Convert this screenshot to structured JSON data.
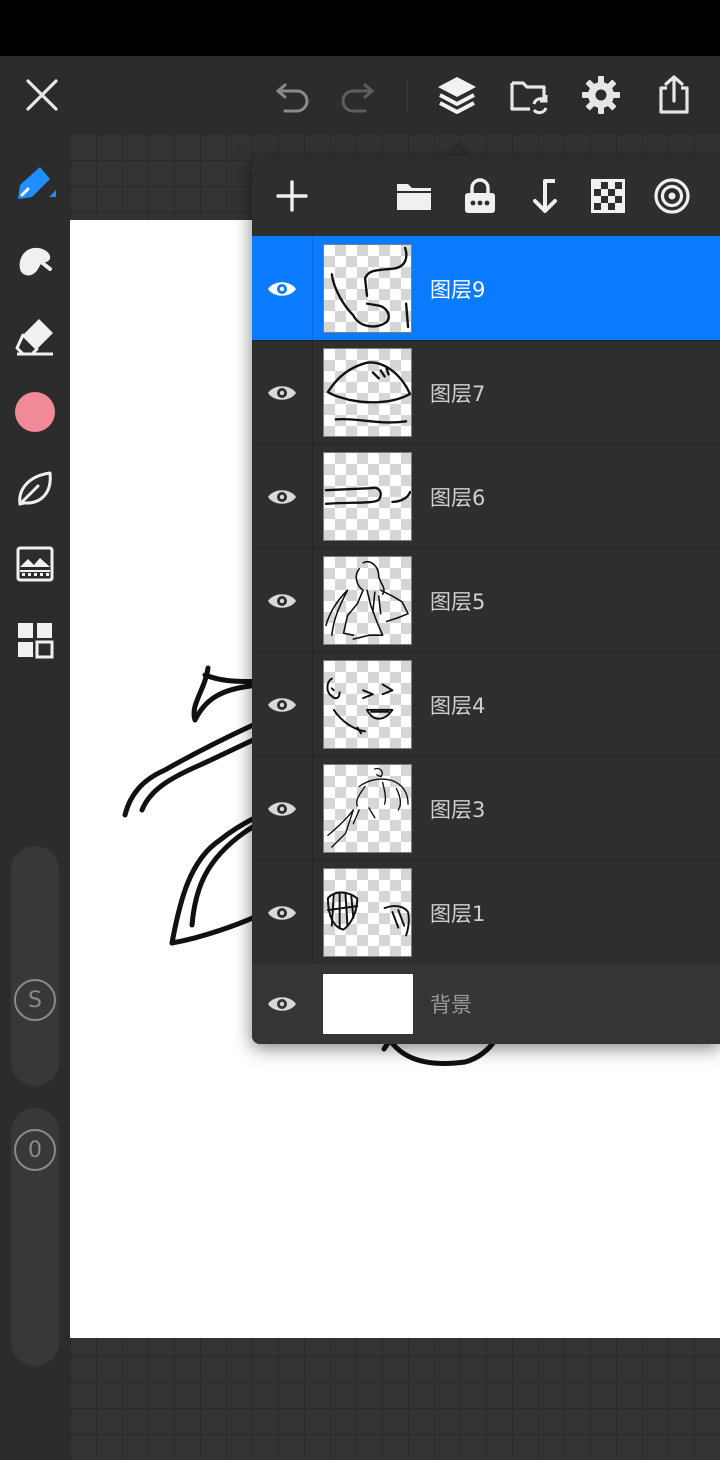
{
  "toolbar": {
    "close_icon": "close-icon",
    "undo_icon": "undo-icon",
    "redo_icon": "redo-icon",
    "layers_icon": "layers-icon",
    "gallery_icon": "folder-sync-icon",
    "settings_icon": "gear-icon",
    "share_icon": "share-icon"
  },
  "sidebar": {
    "tools": [
      "brush-icon",
      "smudge-icon",
      "eraser-icon",
      "color-swatch",
      "leaf-icon",
      "image-adjust-icon",
      "grid-icon"
    ],
    "current_color": "#f08a96",
    "size_slider_label": "S",
    "opacity_slider_label": "0"
  },
  "layers_panel": {
    "actions": [
      "add-layer-icon",
      "folder-icon",
      "lock-icon",
      "merge-down-icon",
      "checker-icon",
      "target-icon"
    ],
    "layers": [
      {
        "name": "图层9",
        "visible": true,
        "selected": true
      },
      {
        "name": "图层7",
        "visible": true,
        "selected": false
      },
      {
        "name": "图层6",
        "visible": true,
        "selected": false
      },
      {
        "name": "图层5",
        "visible": true,
        "selected": false
      },
      {
        "name": "图层4",
        "visible": true,
        "selected": false
      },
      {
        "name": "图层3",
        "visible": true,
        "selected": false
      },
      {
        "name": "图层1",
        "visible": true,
        "selected": false
      }
    ],
    "background": {
      "name": "背景",
      "visible": true
    }
  },
  "colors": {
    "accent": "#0a7aff",
    "toolbar_bg": "#2c2c2c",
    "panel_bg": "#2e2e2e"
  }
}
